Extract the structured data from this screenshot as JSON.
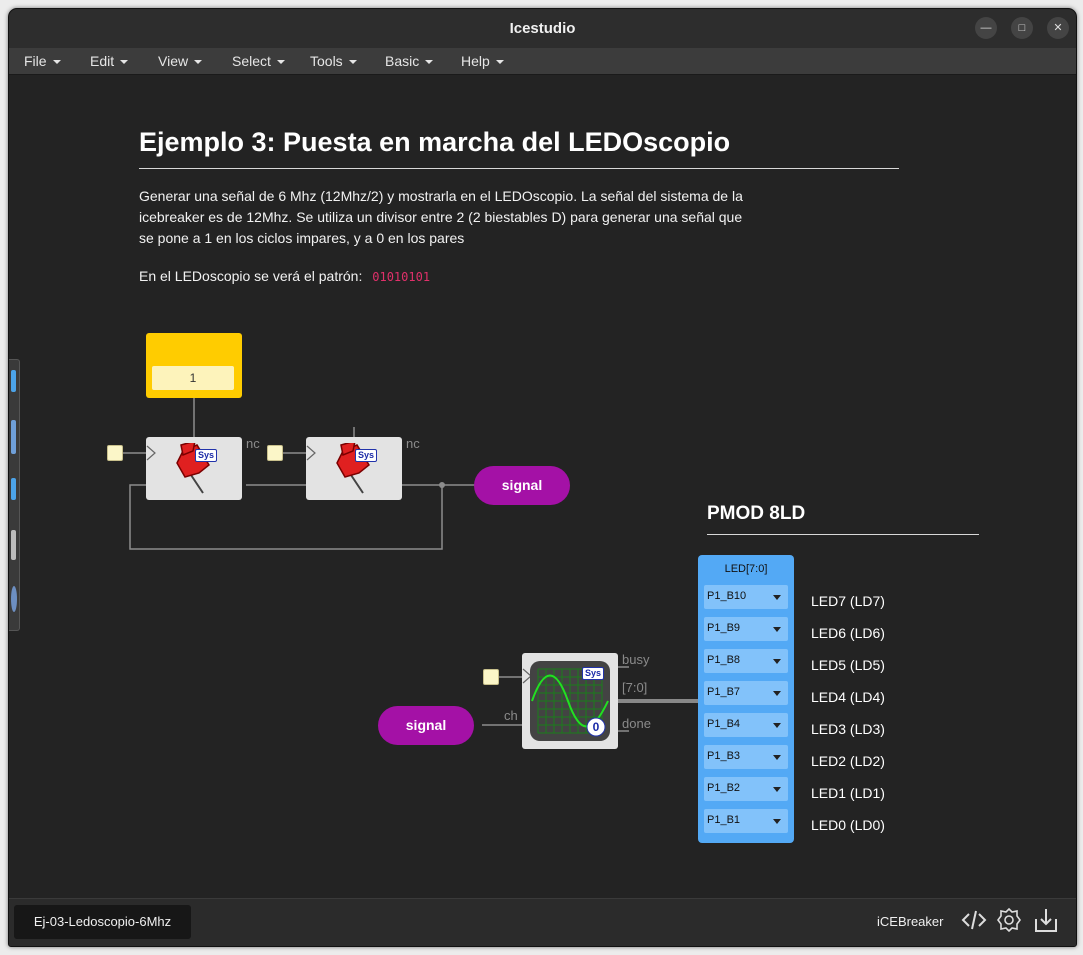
{
  "window": {
    "title": "Icestudio"
  },
  "menu": [
    "File",
    "Edit",
    "View",
    "Select",
    "Tools",
    "Basic",
    "Help"
  ],
  "doc": {
    "title": "Ejemplo 3: Puesta en marcha del LEDOscopio",
    "paragraph": "Generar una señal de 6 Mhz (12Mhz/2) y mostrarla en el LEDOscopio. La señal del sistema de la icebreaker es de 12Mhz. Se utiliza un divisor entre 2 (2 biestables D) para generar una señal que se pone a 1 en los ciclos impares, y a 0 en los pares",
    "pattern_label": "En el LEDoscopio se verá el patrón:",
    "pattern_code": "01010101"
  },
  "circuit": {
    "constant_value": "1",
    "sys_badge": "Sys",
    "nc_label": "nc",
    "signal_label": "signal",
    "scope": {
      "busy": "busy",
      "bus": "[7:0]",
      "done": "done",
      "ch": "ch",
      "counter": "0"
    }
  },
  "pmod": {
    "title": "PMOD 8LD",
    "header": "LED[7:0]",
    "pins": [
      "P1_B10",
      "P1_B9",
      "P1_B8",
      "P1_B7",
      "P1_B4",
      "P1_B3",
      "P1_B2",
      "P1_B1"
    ],
    "leds": [
      "LED7 (LD7)",
      "LED6 (LD6)",
      "LED5 (LD5)",
      "LED4 (LD4)",
      "LED3 (LD3)",
      "LED2 (LD2)",
      "LED1 (LD1)",
      "LED0 (LD0)"
    ]
  },
  "statusbar": {
    "file_tab": "Ej-03-Ledoscopio-6Mhz",
    "board": "iCEBreaker"
  },
  "colors": {
    "constant": "#ffcc00",
    "signal": "#a411a6",
    "pmod": "#53a9f5",
    "pin": "#82c2fa",
    "code": "#e0306a"
  },
  "icons": [
    "minimize-icon",
    "maximize-icon",
    "close-icon",
    "pin-icon",
    "scope-icon",
    "code-icon",
    "settings-icon",
    "download-icon"
  ]
}
